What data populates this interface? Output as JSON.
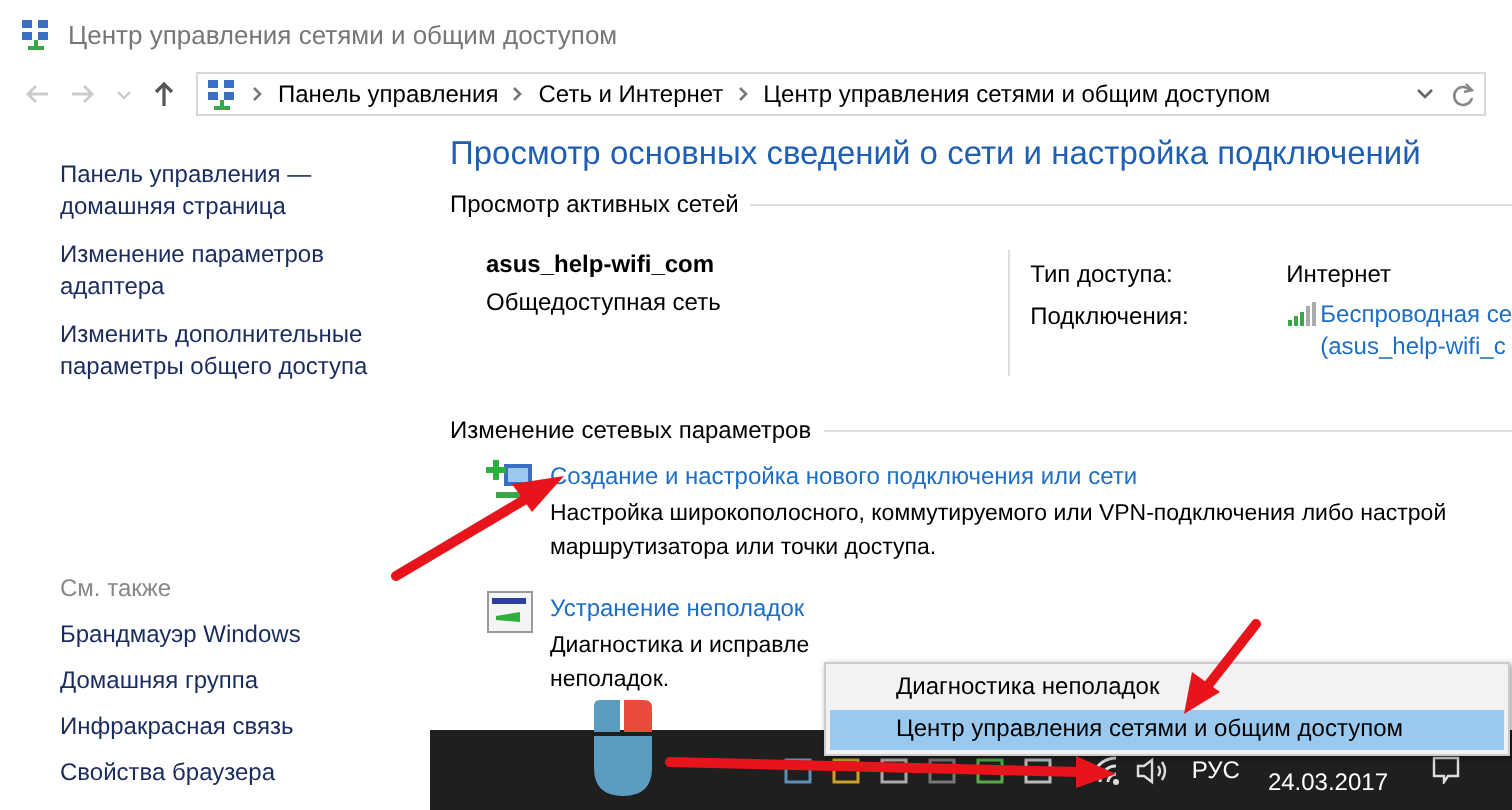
{
  "window": {
    "title": "Центр управления сетями и общим доступом"
  },
  "address_bar": {
    "path": [
      "Панель управления",
      "Сеть и Интернет",
      "Центр управления сетями и общим доступом"
    ]
  },
  "sidebar": {
    "items": [
      "Панель управления — домашняя страница",
      "Изменение параметров адаптера",
      "Изменить дополнительные параметры общего доступа"
    ],
    "see_also": {
      "heading": "См. также",
      "items": [
        "Брандмауэр Windows",
        "Домашняя группа",
        "Инфракрасная связь",
        "Свойства браузера"
      ]
    }
  },
  "main": {
    "heading": "Просмотр основных сведений о сети и настройка подключений",
    "active_networks": {
      "heading": "Просмотр активных сетей",
      "network_name": "asus_help-wifi_com",
      "network_type": "Общедоступная сеть",
      "properties": [
        {
          "kind": "text",
          "label": "Тип доступа:",
          "value": [
            "Интернет"
          ]
        },
        {
          "kind": "link",
          "label": "Подключения:",
          "value": [
            "Беспроводная се",
            "(asus_help-wifi_c"
          ]
        }
      ]
    },
    "change_settings": {
      "heading": "Изменение сетевых параметров",
      "tasks": [
        {
          "kind": "new-connection",
          "link": "Создание и настройка нового подключения или сети",
          "description": [
            "Настройка широкополосного, коммутируемого или VPN-подключения либо настрой",
            "маршрутизатора или точки доступа."
          ]
        },
        {
          "kind": "troubleshoot",
          "link": "Устранение неполадок",
          "description": [
            "Диагностика и исправле",
            "неполадок."
          ]
        }
      ]
    }
  },
  "context_menu": {
    "items": [
      {
        "label": "Диагностика неполадок",
        "selected": false
      },
      {
        "label": "Центр управления сетями и общим доступом",
        "selected": true
      }
    ]
  },
  "taskbar": {
    "language": "РУС",
    "date": "24.03.2017"
  }
}
